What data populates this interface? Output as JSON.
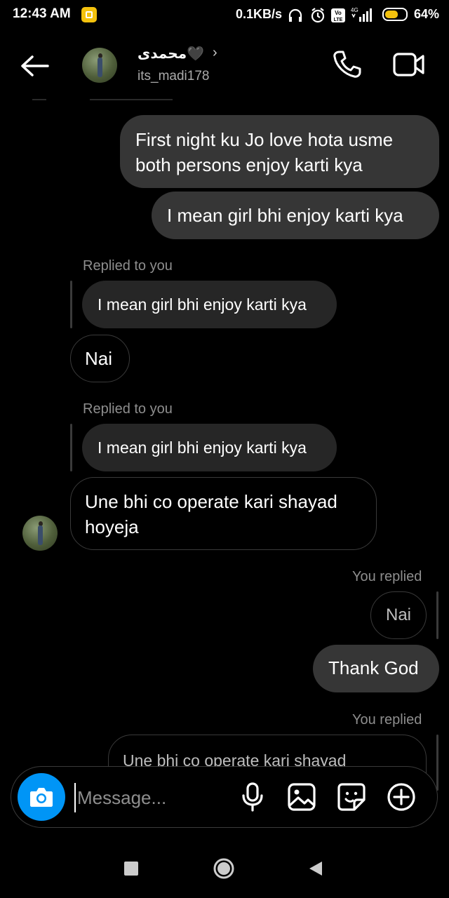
{
  "status_bar": {
    "time": "12:43 AM",
    "speed": "0.1KB/s",
    "icons": [
      "headphones-icon",
      "alarm-icon",
      "volte-icon",
      "signal-icon"
    ],
    "network": "4G",
    "battery_level": 0.64,
    "battery_text": "64%"
  },
  "header": {
    "display_name": "محمدى🖤",
    "username": "its_madi178",
    "chevron": "›"
  },
  "messages": [
    {
      "id": "m1",
      "type": "sent",
      "text": "First night ku Jo love hota usme both persons enjoy karti kya"
    },
    {
      "id": "m2",
      "type": "sent",
      "text": "I mean girl bhi enjoy karti kya"
    },
    {
      "id": "m3",
      "type": "received",
      "meta": "Replied to you",
      "quote": "I mean girl bhi enjoy karti kya",
      "text": "Nai"
    },
    {
      "id": "m4",
      "type": "received",
      "meta": "Replied to you",
      "quote": "I mean girl bhi enjoy karti kya",
      "text": "Une bhi co operate kari shayad hoyeja"
    },
    {
      "id": "m5",
      "type": "sent",
      "meta": "You replied",
      "quote": "Nai",
      "text": "Thank God"
    },
    {
      "id": "m6",
      "type": "sent",
      "meta": "You replied",
      "quote": "Une bhi co operate kari shayad"
    }
  ],
  "composer": {
    "placeholder": "Message..."
  },
  "colors": {
    "accent": "#0095f6",
    "sent_bubble": "#363636",
    "quote_bubble": "#262626",
    "muted_text": "#8e8e8e",
    "battery": "#f4c20d"
  }
}
